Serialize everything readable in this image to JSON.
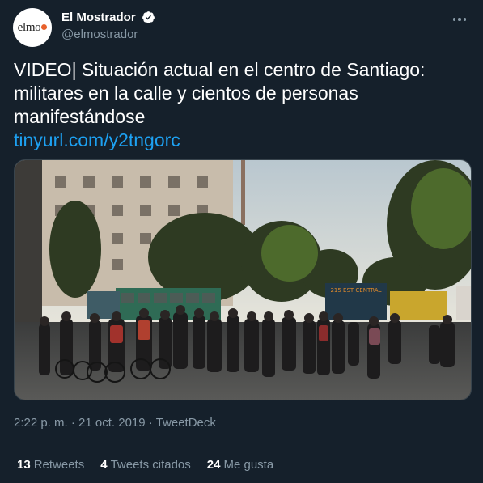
{
  "account": {
    "avatar_text": "elmo",
    "display_name": "El Mostrador",
    "handle": "@elmostrador",
    "verified": true
  },
  "tweet": {
    "text": "VIDEO| Situación actual en el centro de Santiago: militares en la calle y cientos de personas manifestándose",
    "link": "tinyurl.com/y2tngorc"
  },
  "meta": {
    "time": "2:22 p. m.",
    "separator": "·",
    "date": "21 oct. 2019",
    "source": "TweetDeck"
  },
  "stats": {
    "retweets_count": "13",
    "retweets_label": "Retweets",
    "quotes_count": "4",
    "quotes_label": "Tweets citados",
    "likes_count": "24",
    "likes_label": "Me gusta"
  },
  "media": {
    "bus_sign": "215 EST CENTRAL"
  },
  "colors": {
    "background": "#15202b",
    "text_primary": "#ffffff",
    "text_secondary": "#8899a6",
    "link": "#1da1f2",
    "border": "#38444d",
    "avatar_accent": "#e8612c"
  },
  "icons": {
    "verified": "verified-badge-icon",
    "more": "more-options-icon"
  }
}
